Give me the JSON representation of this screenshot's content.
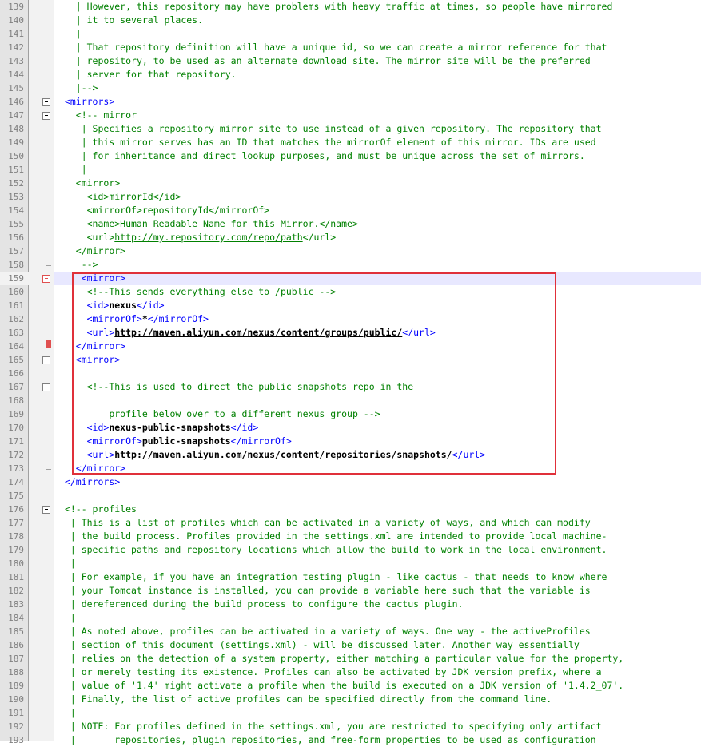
{
  "editor": {
    "current_line": "159",
    "lines": [
      {
        "n": "139",
        "indent": "   ",
        "parts": [
          {
            "k": "c",
            "v": "| However, this repository may have problems with heavy traffic at times, so people have mirrored"
          }
        ],
        "fold": "line"
      },
      {
        "n": "140",
        "indent": "   ",
        "parts": [
          {
            "k": "c",
            "v": "| it to several places."
          }
        ],
        "fold": "line"
      },
      {
        "n": "141",
        "indent": "   ",
        "parts": [
          {
            "k": "c",
            "v": "|"
          }
        ],
        "fold": "line"
      },
      {
        "n": "142",
        "indent": "   ",
        "parts": [
          {
            "k": "c",
            "v": "| That repository definition will have a unique id, so we can create a mirror reference for that"
          }
        ],
        "fold": "line"
      },
      {
        "n": "143",
        "indent": "   ",
        "parts": [
          {
            "k": "c",
            "v": "| repository, to be used as an alternate download site. The mirror site will be the preferred"
          }
        ],
        "fold": "line"
      },
      {
        "n": "144",
        "indent": "   ",
        "parts": [
          {
            "k": "c",
            "v": "| server for that repository."
          }
        ],
        "fold": "line"
      },
      {
        "n": "145",
        "indent": "   ",
        "parts": [
          {
            "k": "c",
            "v": "|-->"
          }
        ],
        "fold": "end"
      },
      {
        "n": "146",
        "indent": " ",
        "parts": [
          {
            "k": "t",
            "v": "<mirrors>"
          }
        ],
        "fold": "box"
      },
      {
        "n": "147",
        "indent": "   ",
        "parts": [
          {
            "k": "c",
            "v": "<!-- mirror"
          }
        ],
        "fold": "box"
      },
      {
        "n": "148",
        "indent": "    ",
        "parts": [
          {
            "k": "c",
            "v": "| Specifies a repository mirror site to use instead of a given repository. The repository that"
          }
        ],
        "fold": "line"
      },
      {
        "n": "149",
        "indent": "    ",
        "parts": [
          {
            "k": "c",
            "v": "| this mirror serves has an ID that matches the mirrorOf element of this mirror. IDs are used"
          }
        ],
        "fold": "line"
      },
      {
        "n": "150",
        "indent": "    ",
        "parts": [
          {
            "k": "c",
            "v": "| for inheritance and direct lookup purposes, and must be unique across the set of mirrors."
          }
        ],
        "fold": "line"
      },
      {
        "n": "151",
        "indent": "    ",
        "parts": [
          {
            "k": "c",
            "v": "|"
          }
        ],
        "fold": "line"
      },
      {
        "n": "152",
        "indent": "   ",
        "parts": [
          {
            "k": "c",
            "v": "<mirror>"
          }
        ],
        "fold": "line"
      },
      {
        "n": "153",
        "indent": "     ",
        "parts": [
          {
            "k": "c",
            "v": "<id>mirrorId</id>"
          }
        ],
        "fold": "line"
      },
      {
        "n": "154",
        "indent": "     ",
        "parts": [
          {
            "k": "c",
            "v": "<mirrorOf>repositoryId</mirrorOf>"
          }
        ],
        "fold": "line"
      },
      {
        "n": "155",
        "indent": "     ",
        "parts": [
          {
            "k": "c",
            "v": "<name>Human Readable Name for this Mirror.</name>"
          }
        ],
        "fold": "line"
      },
      {
        "n": "156",
        "indent": "     ",
        "parts": [
          {
            "k": "c",
            "v": "<url>"
          },
          {
            "k": "c u",
            "v": "http://my.repository.com/repo/path"
          },
          {
            "k": "c",
            "v": "</url>"
          }
        ],
        "fold": "line"
      },
      {
        "n": "157",
        "indent": "   ",
        "parts": [
          {
            "k": "c",
            "v": "</mirror>"
          }
        ],
        "fold": "line"
      },
      {
        "n": "158",
        "indent": "    ",
        "parts": [
          {
            "k": "c",
            "v": "-->"
          }
        ],
        "fold": "end"
      },
      {
        "n": "159",
        "indent": "    ",
        "parts": [
          {
            "k": "t",
            "v": "<mirror>"
          }
        ],
        "fold": "redbox"
      },
      {
        "n": "160",
        "indent": "     ",
        "parts": [
          {
            "k": "c",
            "v": "<!--This sends everything else to /public -->"
          }
        ],
        "fold": "redline"
      },
      {
        "n": "161",
        "indent": "     ",
        "parts": [
          {
            "k": "t",
            "v": "<id>"
          },
          {
            "k": "b",
            "v": "nexus"
          },
          {
            "k": "t",
            "v": "</id>"
          }
        ],
        "fold": "redline"
      },
      {
        "n": "162",
        "indent": "     ",
        "parts": [
          {
            "k": "t",
            "v": "<mirrorOf>"
          },
          {
            "k": "b",
            "v": "*"
          },
          {
            "k": "t",
            "v": "</mirrorOf>"
          }
        ],
        "fold": "redline"
      },
      {
        "n": "163",
        "indent": "     ",
        "parts": [
          {
            "k": "t",
            "v": "<url>"
          },
          {
            "k": "b u",
            "v": "http://maven.aliyun.com/nexus/content/groups/public/"
          },
          {
            "k": "t",
            "v": "</url>"
          }
        ],
        "fold": "redline"
      },
      {
        "n": "164",
        "indent": "   ",
        "parts": [
          {
            "k": "t",
            "v": "</mirror>"
          }
        ],
        "fold": "redend"
      },
      {
        "n": "165",
        "indent": "   ",
        "parts": [
          {
            "k": "t",
            "v": "<mirror>"
          }
        ],
        "fold": "box"
      },
      {
        "n": "166",
        "indent": "",
        "parts": [],
        "fold": "line"
      },
      {
        "n": "167",
        "indent": "     ",
        "parts": [
          {
            "k": "c",
            "v": "<!--This is used to direct the public snapshots repo in the"
          }
        ],
        "fold": "box"
      },
      {
        "n": "168",
        "indent": "",
        "parts": [],
        "fold": "line"
      },
      {
        "n": "169",
        "indent": "         ",
        "parts": [
          {
            "k": "c",
            "v": "profile below over to a different nexus group -->"
          }
        ],
        "fold": "end"
      },
      {
        "n": "170",
        "indent": "     ",
        "parts": [
          {
            "k": "t",
            "v": "<id>"
          },
          {
            "k": "b",
            "v": "nexus-public-snapshots"
          },
          {
            "k": "t",
            "v": "</id>"
          }
        ],
        "fold": "line"
      },
      {
        "n": "171",
        "indent": "     ",
        "parts": [
          {
            "k": "t",
            "v": "<mirrorOf>"
          },
          {
            "k": "b",
            "v": "public-snapshots"
          },
          {
            "k": "t",
            "v": "</mirrorOf>"
          }
        ],
        "fold": "line"
      },
      {
        "n": "172",
        "indent": "     ",
        "parts": [
          {
            "k": "t",
            "v": "<url>"
          },
          {
            "k": "b u",
            "v": "http://maven.aliyun.com/nexus/content/repositories/snapshots/"
          },
          {
            "k": "t",
            "v": "</url>"
          }
        ],
        "fold": "line"
      },
      {
        "n": "173",
        "indent": "   ",
        "parts": [
          {
            "k": "t",
            "v": "</mirror>"
          }
        ],
        "fold": "end"
      },
      {
        "n": "174",
        "indent": " ",
        "parts": [
          {
            "k": "t",
            "v": "</mirrors>"
          }
        ],
        "fold": "end"
      },
      {
        "n": "175",
        "indent": "",
        "parts": [],
        "fold": "none"
      },
      {
        "n": "176",
        "indent": " ",
        "parts": [
          {
            "k": "c",
            "v": "<!-- profiles"
          }
        ],
        "fold": "box"
      },
      {
        "n": "177",
        "indent": "  ",
        "parts": [
          {
            "k": "c",
            "v": "| This is a list of profiles which can be activated in a variety of ways, and which can modify"
          }
        ],
        "fold": "line"
      },
      {
        "n": "178",
        "indent": "  ",
        "parts": [
          {
            "k": "c",
            "v": "| the build process. Profiles provided in the settings.xml are intended to provide local machine-"
          }
        ],
        "fold": "line"
      },
      {
        "n": "179",
        "indent": "  ",
        "parts": [
          {
            "k": "c",
            "v": "| specific paths and repository locations which allow the build to work in the local environment."
          }
        ],
        "fold": "line"
      },
      {
        "n": "180",
        "indent": "  ",
        "parts": [
          {
            "k": "c",
            "v": "|"
          }
        ],
        "fold": "line"
      },
      {
        "n": "181",
        "indent": "  ",
        "parts": [
          {
            "k": "c",
            "v": "| For example, if you have an integration testing plugin - like cactus - that needs to know where"
          }
        ],
        "fold": "line"
      },
      {
        "n": "182",
        "indent": "  ",
        "parts": [
          {
            "k": "c",
            "v": "| your Tomcat instance is installed, you can provide a variable here such that the variable is"
          }
        ],
        "fold": "line"
      },
      {
        "n": "183",
        "indent": "  ",
        "parts": [
          {
            "k": "c",
            "v": "| dereferenced during the build process to configure the cactus plugin."
          }
        ],
        "fold": "line"
      },
      {
        "n": "184",
        "indent": "  ",
        "parts": [
          {
            "k": "c",
            "v": "|"
          }
        ],
        "fold": "line"
      },
      {
        "n": "185",
        "indent": "  ",
        "parts": [
          {
            "k": "c",
            "v": "| As noted above, profiles can be activated in a variety of ways. One way - the activeProfiles"
          }
        ],
        "fold": "line"
      },
      {
        "n": "186",
        "indent": "  ",
        "parts": [
          {
            "k": "c",
            "v": "| section of this document (settings.xml) - will be discussed later. Another way essentially"
          }
        ],
        "fold": "line"
      },
      {
        "n": "187",
        "indent": "  ",
        "parts": [
          {
            "k": "c",
            "v": "| relies on the detection of a system property, either matching a particular value for the property,"
          }
        ],
        "fold": "line"
      },
      {
        "n": "188",
        "indent": "  ",
        "parts": [
          {
            "k": "c",
            "v": "| or merely testing its existence. Profiles can also be activated by JDK version prefix, where a"
          }
        ],
        "fold": "line"
      },
      {
        "n": "189",
        "indent": "  ",
        "parts": [
          {
            "k": "c",
            "v": "| value of '1.4' might activate a profile when the build is executed on a JDK version of '1.4.2_07'."
          }
        ],
        "fold": "line"
      },
      {
        "n": "190",
        "indent": "  ",
        "parts": [
          {
            "k": "c",
            "v": "| Finally, the list of active profiles can be specified directly from the command line."
          }
        ],
        "fold": "line"
      },
      {
        "n": "191",
        "indent": "  ",
        "parts": [
          {
            "k": "c",
            "v": "|"
          }
        ],
        "fold": "line"
      },
      {
        "n": "192",
        "indent": "  ",
        "parts": [
          {
            "k": "c",
            "v": "| NOTE: For profiles defined in the settings.xml, you are restricted to specifying only artifact"
          }
        ],
        "fold": "line"
      },
      {
        "n": "193",
        "indent": "  ",
        "parts": [
          {
            "k": "c",
            "v": "|       repositories, plugin repositories, and free-form properties to be used as configuration"
          }
        ],
        "fold": "line"
      }
    ]
  }
}
